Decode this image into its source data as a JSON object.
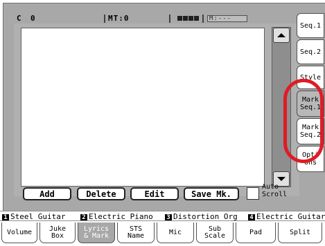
{
  "status": {
    "chord": "C",
    "beat": "0",
    "measure_label": "MT:0",
    "meter_label": "M:---"
  },
  "scroll": {
    "up_icon": "triangle-up",
    "down_icon": "triangle-down"
  },
  "buttons": {
    "add": "Add",
    "delete": "Delete",
    "edit": "Edit",
    "save_mark": "Save Mk."
  },
  "auto_scroll": {
    "label_line1": "Auto",
    "label_line2": "Scroll",
    "checked": false
  },
  "side_tabs": [
    {
      "line1": "Seq.1",
      "line2": ""
    },
    {
      "line1": "Seq.2",
      "line2": ""
    },
    {
      "line1": "Style",
      "line2": ""
    },
    {
      "line1": "Mark",
      "line2": "Seq.1"
    },
    {
      "line1": "Mark",
      "line2": "Seq.2"
    },
    {
      "line1": "Opti",
      "line2": "ons"
    }
  ],
  "tracks": [
    {
      "num": "1",
      "name": "Steel Guitar"
    },
    {
      "num": "2",
      "name": "Electric Piano"
    },
    {
      "num": "3",
      "name": "Distortion Org"
    },
    {
      "num": "4",
      "name": "Electric Guitar"
    }
  ],
  "bottom_tabs": [
    {
      "line1": "Volume",
      "line2": ""
    },
    {
      "line1": "Juke",
      "line2": "Box"
    },
    {
      "line1": "Lyrics",
      "line2": "& Mark"
    },
    {
      "line1": "STS",
      "line2": "Name"
    },
    {
      "line1": "Mic",
      "line2": ""
    },
    {
      "line1": "Sub",
      "line2": "Scale"
    },
    {
      "line1": "Pad",
      "line2": ""
    },
    {
      "line1": "Split",
      "line2": ""
    }
  ],
  "colors": {
    "highlight": "#e01b24",
    "panel": "#a8a8a8",
    "selected_tab": "#a8a8a8"
  }
}
